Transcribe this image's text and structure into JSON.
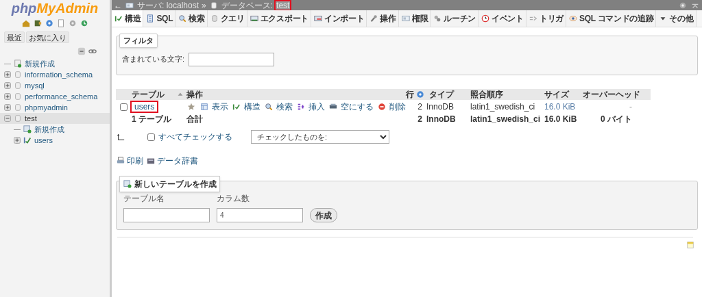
{
  "sidebar": {
    "logo": {
      "part_1": "php",
      "part_2": "MyAdmin"
    },
    "tabs": [
      {
        "label": "最近"
      },
      {
        "label": "お気に入り"
      }
    ],
    "tree": [
      {
        "kind": "new",
        "name": "新規作成",
        "selected": false
      },
      {
        "kind": "db",
        "name": "information_schema",
        "expanded": false,
        "selected": false
      },
      {
        "kind": "db",
        "name": "mysql",
        "expanded": false,
        "selected": false
      },
      {
        "kind": "db",
        "name": "performance_schema",
        "expanded": false,
        "selected": false
      },
      {
        "kind": "db",
        "name": "phpmyadmin",
        "expanded": false,
        "selected": false
      },
      {
        "kind": "db",
        "name": "test",
        "expanded": true,
        "selected": true,
        "children": [
          {
            "kind": "new",
            "name": "新規作成",
            "selected": false
          },
          {
            "kind": "table",
            "name": "users",
            "expanded": false,
            "selected": false
          }
        ]
      }
    ]
  },
  "breadcrumb": {
    "back": "←",
    "server": "サーバ: localhost",
    "separator": "»",
    "db_label": "データベース:",
    "db_name": "test",
    "db_highlighted": true
  },
  "tabs": [
    {
      "label": "構造",
      "selected": true
    },
    {
      "label": "SQL",
      "selected": false
    },
    {
      "label": "検索",
      "selected": false
    },
    {
      "label": "クエリ",
      "selected": false
    },
    {
      "label": "エクスポート",
      "selected": false
    },
    {
      "label": "インポート",
      "selected": false
    },
    {
      "label": "操作",
      "selected": false
    },
    {
      "label": "権限",
      "selected": false
    },
    {
      "label": "ルーチン",
      "selected": false
    },
    {
      "label": "イベント",
      "selected": false
    },
    {
      "label": "トリガ",
      "selected": false
    },
    {
      "label": "SQL コマンドの追跡",
      "selected": false
    },
    {
      "label": "その他",
      "selected": false
    }
  ],
  "filter": {
    "legend": "フィルタ",
    "label": "含まれている文字:"
  },
  "table": {
    "columns": [
      {
        "label": "テーブル",
        "sorted": true
      },
      {
        "label": "操作"
      },
      {
        "label": "行",
        "help": true
      },
      {
        "label": "タイプ"
      },
      {
        "label": "照合順序"
      },
      {
        "label": "サイズ"
      },
      {
        "label": "オーバーヘッド"
      }
    ],
    "rows": [
      {
        "name": "users",
        "highlighted": true,
        "checked": false,
        "actions": [
          "表示",
          "構造",
          "検索",
          "挿入",
          "空にする",
          "削除"
        ],
        "rows": "2",
        "type": "InnoDB",
        "collation": "latin1_swedish_ci",
        "size": "16.0 KiB",
        "overhead": "-"
      }
    ],
    "footer": {
      "count": "1 テーブル",
      "sum": "合計",
      "rows": "2",
      "type": "InnoDB",
      "collation": "latin1_swedish_ci",
      "size": "16.0 KiB",
      "overhead": "0 バイト"
    }
  },
  "bulk": {
    "check_all": "すべてチェックする",
    "checked": false,
    "select": "チェックしたものを:"
  },
  "links": [
    "印刷",
    "データ辞書"
  ],
  "create": {
    "legend": "新しいテーブルを作成",
    "name_label": "テーブル名",
    "columns_label": "カラム数",
    "columns_value": "4",
    "button": "作成"
  }
}
